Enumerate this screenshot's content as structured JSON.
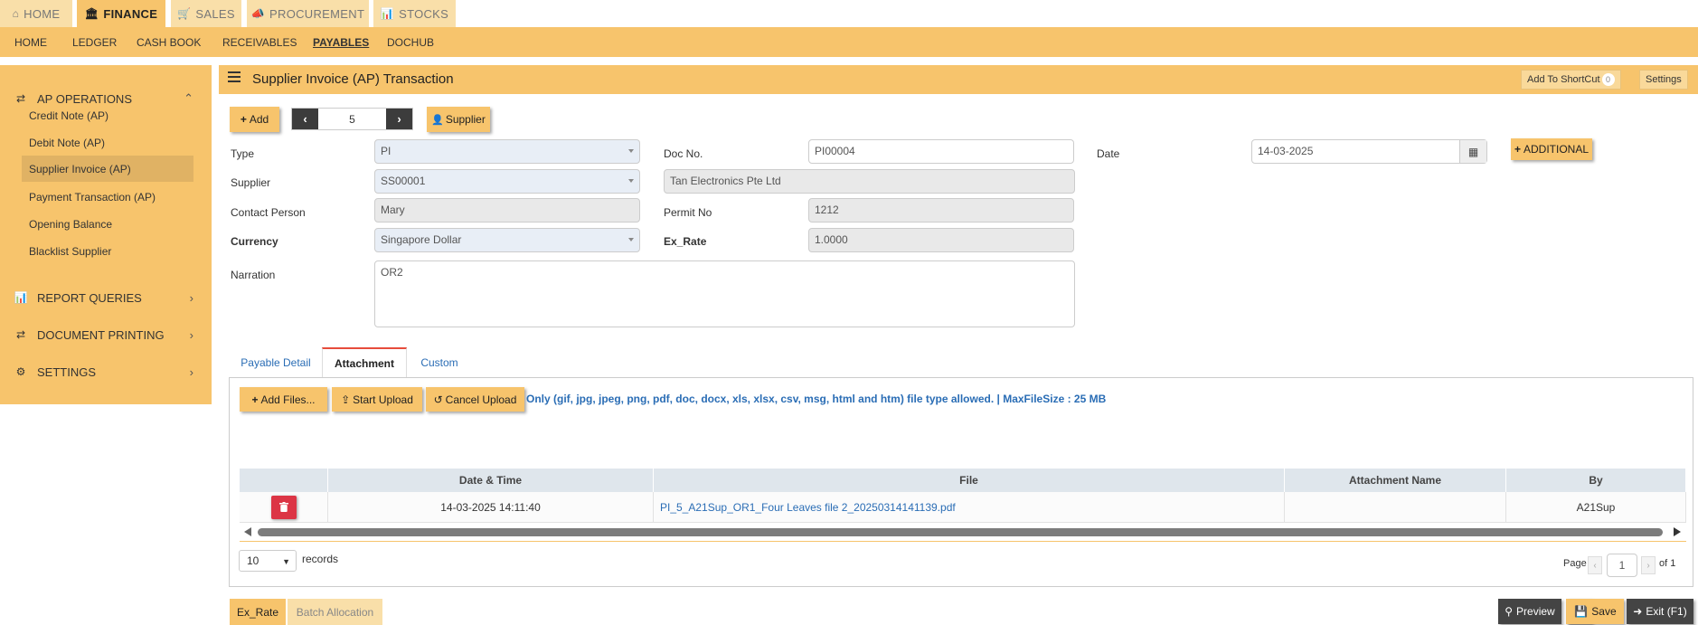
{
  "modules": [
    {
      "label": "HOME",
      "icon": "home-icon",
      "active": false
    },
    {
      "label": "FINANCE",
      "icon": "bank-icon",
      "active": true
    },
    {
      "label": "SALES",
      "icon": "cart-icon",
      "active": false
    },
    {
      "label": "PROCUREMENT",
      "icon": "bullhorn-icon",
      "active": false
    },
    {
      "label": "STOCKS",
      "icon": "bar-chart-icon",
      "active": false
    }
  ],
  "submenu": [
    "HOME",
    "LEDGER",
    "CASH BOOK",
    "RECEIVABLES",
    "PAYABLES",
    "DOCHUB"
  ],
  "submenu_active": "PAYABLES",
  "sidebar": {
    "section": "AP OPERATIONS",
    "items": [
      "Credit Note (AP)",
      "Debit Note (AP)",
      "Supplier Invoice (AP)",
      "Payment Transaction (AP)",
      "Opening Balance",
      "Blacklist Supplier"
    ],
    "active_item": "Supplier Invoice (AP)",
    "groups": [
      "REPORT QUERIES",
      "DOCUMENT PRINTING",
      "SETTINGS"
    ]
  },
  "titlebar": {
    "title": "Supplier Invoice (AP) Transaction",
    "shortcut_label": "Add To ShortCut",
    "shortcut_count": "0",
    "settings_label": "Settings"
  },
  "toolbar": {
    "add_label": "Add",
    "record_number": "5",
    "supplier_label": "Supplier"
  },
  "form": {
    "type_label": "Type",
    "type_value": "PI",
    "docno_label": "Doc No.",
    "docno_value": "PI00004",
    "date_label": "Date",
    "date_value": "14-03-2025",
    "additional_label": "ADDITIONAL",
    "supplier_label": "Supplier",
    "supplier_code": "SS00001",
    "supplier_name": "Tan Electronics Pte Ltd",
    "contact_label": "Contact Person",
    "contact_value": "Mary",
    "permit_label": "Permit No",
    "permit_value": "1212",
    "currency_label": "Currency",
    "currency_value": "Singapore Dollar",
    "exrate_label": "Ex_Rate",
    "exrate_value": "1.0000",
    "narration_label": "Narration",
    "narration_value": "OR2"
  },
  "tabs": [
    "Payable Detail",
    "Attachment",
    "Custom"
  ],
  "tab_active": "Attachment",
  "attachment": {
    "add_files_label": "Add Files...",
    "start_upload_label": "Start Upload",
    "cancel_upload_label": "Cancel Upload",
    "info": "Only (gif, jpg, jpeg, png, pdf, doc, docx, xls, xlsx, csv, msg, html and htm) file type allowed. | MaxFileSize : 25 MB",
    "columns": [
      "",
      "Date & Time",
      "File",
      "Attachment Name",
      "By"
    ],
    "rows": [
      {
        "datetime": "14-03-2025 14:11:40",
        "file": "PI_5_A21Sup_OR1_Four Leaves file 2_20250314141139.pdf",
        "name": "",
        "by": "A21Sup"
      }
    ],
    "page_size": "10",
    "records_label": "records",
    "page_label": "Page",
    "page_value": "1",
    "of_label": "of 1"
  },
  "bottom": {
    "tabs": [
      "Ex_Rate",
      "Batch Allocation"
    ],
    "preview_label": "Preview",
    "save_label": "Save",
    "exit_label": "Exit (F1)"
  }
}
